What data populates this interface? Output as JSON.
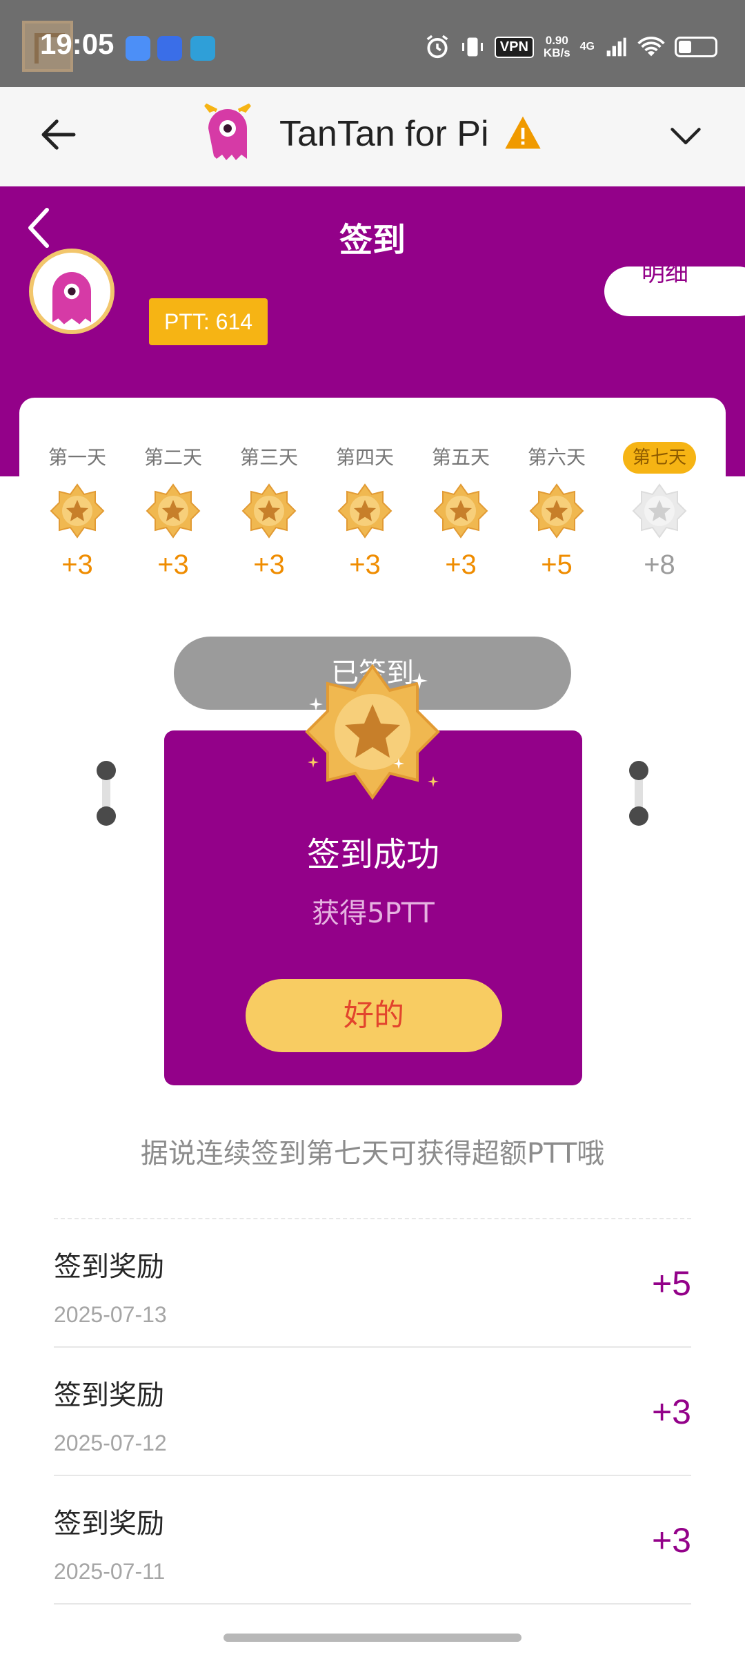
{
  "status_bar": {
    "time": "19:05",
    "vpn": "VPN",
    "speed_value": "0.90",
    "speed_unit": "KB/s",
    "network": "4G"
  },
  "header": {
    "title": "TanTan for Pi"
  },
  "page": {
    "title": "签到",
    "ptt_balance": "PTT: 614",
    "detail_label": "明细"
  },
  "days": [
    {
      "label": "第一天",
      "points": "+3",
      "checked": true
    },
    {
      "label": "第二天",
      "points": "+3",
      "checked": true
    },
    {
      "label": "第三天",
      "points": "+3",
      "checked": true
    },
    {
      "label": "第四天",
      "points": "+3",
      "checked": true
    },
    {
      "label": "第五天",
      "points": "+3",
      "checked": true
    },
    {
      "label": "第六天",
      "points": "+5",
      "checked": true
    },
    {
      "label": "第七天",
      "points": "+8",
      "checked": false
    }
  ],
  "signed_button": "已签到",
  "popup": {
    "title": "签到成功",
    "subtitle": "获得5PTT",
    "ok_label": "好的"
  },
  "hint": "据说连续签到第七天可获得超额PTT哦",
  "records": [
    {
      "title": "签到奖励",
      "date": "2025-07-13",
      "points": "+5"
    },
    {
      "title": "签到奖励",
      "date": "2025-07-12",
      "points": "+3"
    },
    {
      "title": "签到奖励",
      "date": "2025-07-11",
      "points": "+3"
    }
  ],
  "colors": {
    "brand_purple": "#930189",
    "gold": "#f6b414",
    "points_orange": "#ef8c00"
  }
}
